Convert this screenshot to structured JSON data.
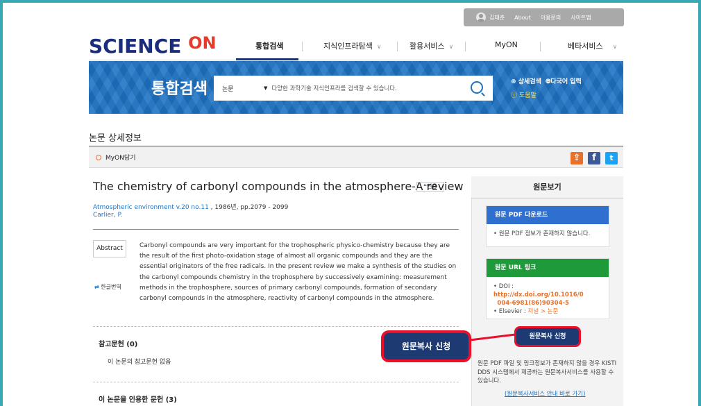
{
  "util_bar": {
    "user": "김태춘",
    "about": "About",
    "guide": "이용문의",
    "sitemap": "사이트맵"
  },
  "logo": {
    "text": "SCIENCE",
    "accent": "ON"
  },
  "nav": {
    "items": [
      "통합검색",
      "지식인프라탐색",
      "활용서비스",
      "MyON",
      "베타서비스"
    ]
  },
  "banner": {
    "title": "통합검색",
    "category": "논문",
    "placeholder": "다양한 과학기술 지식인프라를 검색할 수 있습니다.",
    "advanced": "상세검색",
    "multilang": "다국어 입력",
    "help": "도움말"
  },
  "page": {
    "title": "논문 상세정보",
    "myon": "MyON담기"
  },
  "article": {
    "title": "The chemistry of carbonyl compounds in the atmosphere-A review",
    "cite_label": "인용",
    "journal_link": "Atmospheric environment v.20 no.11",
    "journal_rest": " , 1986년, pp.2079 - 2099",
    "author": "Carlier, P.",
    "abstract_label": "Abstract",
    "translate_label": "한글번역",
    "abstract": "Carbonyl compounds are very important for the trophospheric physico-chemistry because they are the result of the first photo-oxidation stage of almost all organic compounds and they are the essential originators of the free radicals. In the present review we make a synthesis of the studies on the carbonyl compounds chemistry in the trophosphere by successively examining: measurement methods in the trophosphere, sources of primary carbonyl compounds, formation of secondary carbonyl compounds in the atmosphere, reactivity of carbonyl compounds in the atmosphere."
  },
  "references": {
    "title": "참고문헌 (0)",
    "none": "이 논문의 참고문헌 없음"
  },
  "cited": {
    "title": "이 논문을 인용한 문헌 (3)"
  },
  "right_panel": {
    "title": "원문보기",
    "pdf_header": "원문 PDF 다운로드",
    "pdf_text": "원문 PDF 정보가 존재하지 않습니다.",
    "url_header": "원문 URL 링크",
    "doi_label": "DOI : ",
    "doi_line1": "http://dx.doi.org/10.1016/0",
    "doi_line2": "004-6981(86)90304-5",
    "elsevier_label": "Elsevier : ",
    "elsevier_link": "저널 > 논문",
    "copy_button": "원문복사 신청",
    "note": "원문 PDF 파일 및 링크정보가 존재하지 않을 경우 KISTI DDS 시스템에서 제공하는 원문복사서비스를 사용할 수 있습니다.",
    "guide_link": "(원문복사서비스 안내 바로 가기)"
  },
  "callout": {
    "label": "원문복사 신청"
  },
  "colors": {
    "frame": "#3aa7b5",
    "banner": "#1e73c4",
    "navy": "#1d3a72",
    "highlight": "#e8102a",
    "pdf_header": "#2f6fcf",
    "url_header": "#1e9a3a"
  }
}
